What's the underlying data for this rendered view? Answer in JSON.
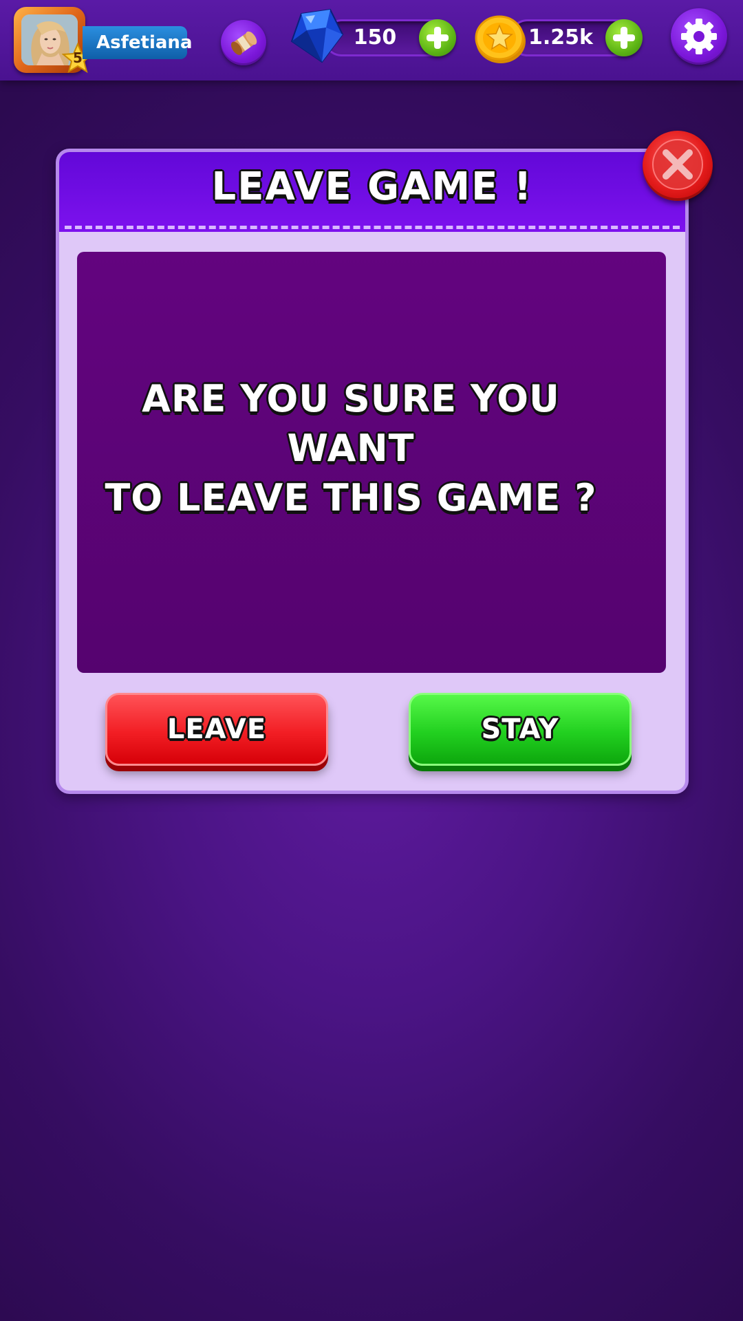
{
  "topbar": {
    "username": "Asfetiana",
    "level": "5",
    "gems": "150",
    "coins": "1.25k",
    "icons": {
      "avatar": "avatar-photo",
      "level": "star-icon",
      "scroll": "scroll-icon",
      "gems": "gem-icon",
      "coins": "coin-icon",
      "add": "plus-icon",
      "settings": "gear-icon"
    }
  },
  "dialog": {
    "title": "LEAVE GAME !",
    "message_line1": "ARE YOU SURE YOU WANT",
    "message_line2": "TO LEAVE THIS GAME ?",
    "leave_label": "LEAVE",
    "stay_label": "STAY",
    "close_icon": "close-icon"
  },
  "colors": {
    "background": "#4b1485",
    "header": "#6208d8",
    "panel": "#dfc8f8",
    "message_panel": "#5c0378",
    "leave": "#f21e24",
    "stay": "#22d020",
    "close": "#e31b1b"
  }
}
